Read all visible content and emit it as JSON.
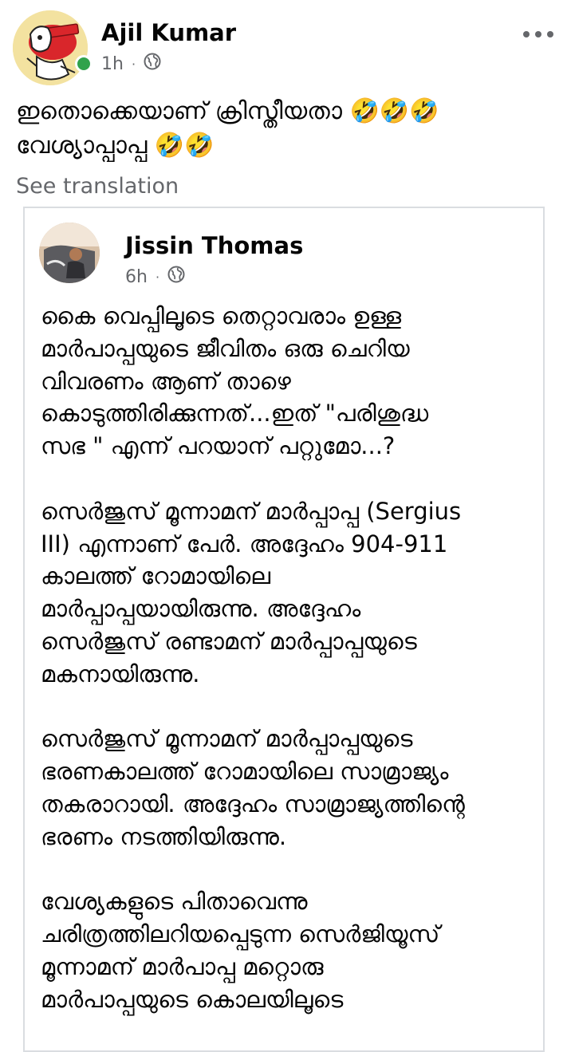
{
  "post": {
    "author": "Ajil Kumar",
    "time": "1h",
    "separator": "·",
    "privacy_icon": "globe-icon",
    "more_icon": "more-options-icon",
    "text_lines": [
      "ഇതൊക്കെയാണ് ക്രിസ്തീയതാ 🤣🤣🤣",
      "വേശ്യാപ്പാപ്പ 🤣🤣"
    ],
    "see_translation": "See translation"
  },
  "shared": {
    "author": "Jissin Thomas",
    "time": "6h",
    "separator": "·",
    "privacy_icon": "globe-icon",
    "paragraphs": [
      [
        "കൈ വെപ്പിലൂടെ തെറ്റാവരാം ഉള്ള",
        "മാര്‍പാപ്പയുടെ ജീവിതം ഒരു ചെറിയ",
        "വിവരണം ആണ് താഴെ",
        "കൊടുത്തിരിക്കുന്നത്...ഇത് \"പരിശുദ്ധ",
        "സഭ \" എന്ന് പറയാന് പറ്റുമോ...?"
      ],
      [
        "സെര്‍ജുസ് മൂന്നാമന് മാര്‍പ്പാപ്പ (Sergius",
        "III) എന്നാണ് പേര്‍. അദ്ദേഹം 904-911",
        "കാലത്ത് റോമായിലെ",
        "മാര്‍പ്പാപ്പയായിരുന്നു. അദ്ദേഹം",
        "സെര്‍ജുസ് രണ്ടാമന് മാര്‍പ്പാപ്പയുടെ",
        "മകനായിരുന്നു."
      ],
      [
        "സെര്‍ജുസ് മൂന്നാമന് മാര്‍പ്പാപ്പയുടെ",
        "ഭരണകാലത്ത് റോമായിലെ സാമ്രാജ്യം",
        "തകരാറായി. അദ്ദേഹം സാമ്രാജ്യത്തിന്റെ",
        "ഭരണം നടത്തിയിരുന്നു."
      ],
      [
        "വേശ്യകളുടെ പിതാവെന്നു",
        "ചരിത്രത്തിലറിയപ്പെടുന്ന സെര്‍ജിയൂസ്",
        "മൂന്നാമന് മാര്‍പാപ്പ മറ്റൊരു",
        "മാര്‍പാപ്പയുടെ കൊലയിലൂടെ"
      ]
    ]
  },
  "colors": {
    "text": "#050505",
    "meta": "#65676b",
    "online": "#31a24c",
    "border": "#dadde1"
  }
}
